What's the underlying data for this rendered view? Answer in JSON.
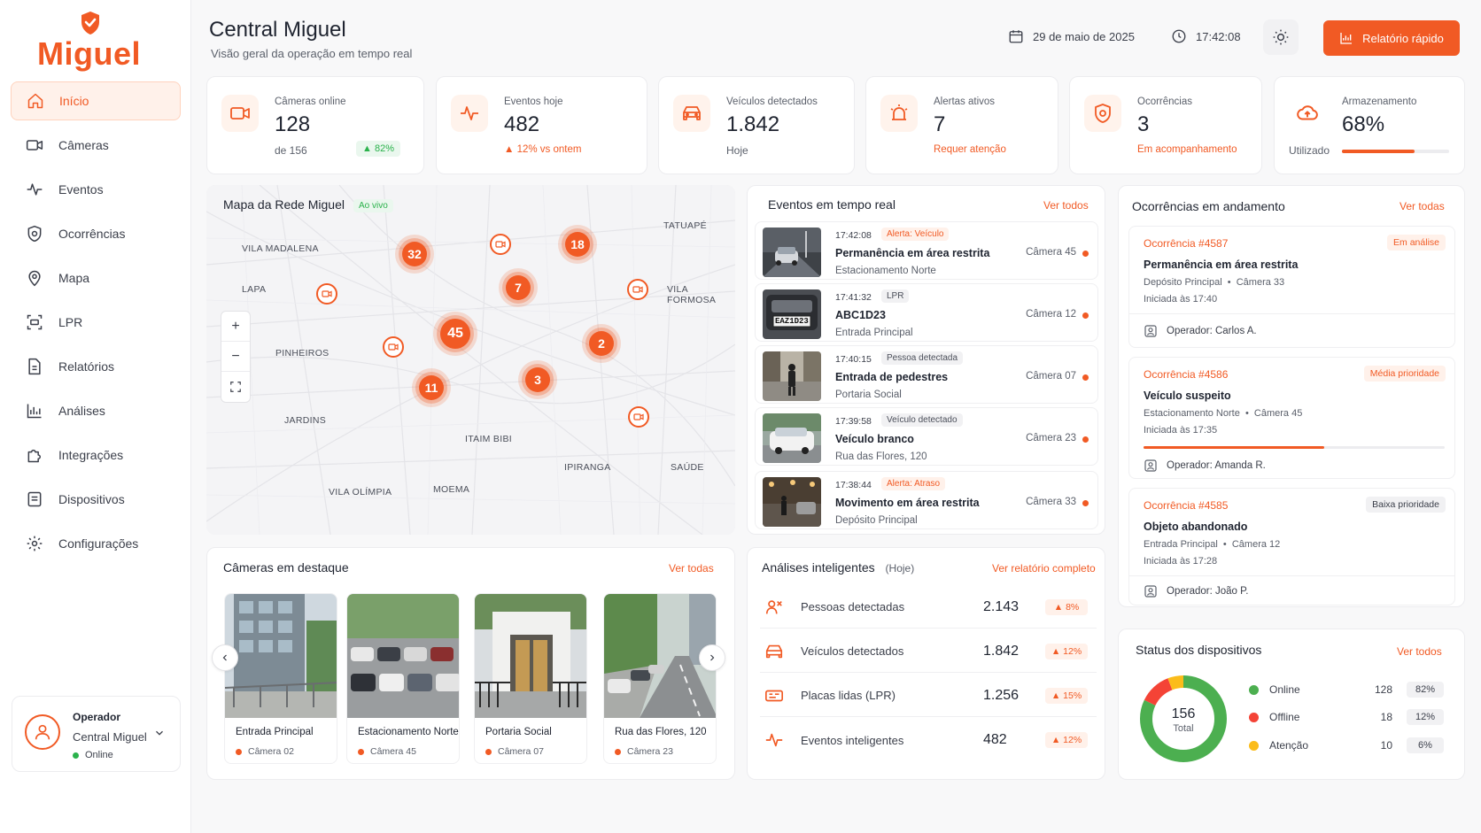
{
  "brand": {
    "name": "Miguel",
    "accent": "#f15a24"
  },
  "sidebar": {
    "items": [
      {
        "label": "Início",
        "icon": "home-icon"
      },
      {
        "label": "Câmeras",
        "icon": "camera-icon"
      },
      {
        "label": "Eventos",
        "icon": "activity-icon"
      },
      {
        "label": "Ocorrências",
        "icon": "shield-icon"
      },
      {
        "label": "Mapa",
        "icon": "map-pin-icon"
      },
      {
        "label": "LPR",
        "icon": "scan-plate-icon"
      },
      {
        "label": "Relatórios",
        "icon": "document-icon"
      },
      {
        "label": "Análises",
        "icon": "bar-chart-icon"
      },
      {
        "label": "Integrações",
        "icon": "puzzle-icon"
      },
      {
        "label": "Dispositivos",
        "icon": "device-icon"
      },
      {
        "label": "Configurações",
        "icon": "gear-icon"
      }
    ],
    "operator": {
      "role": "Operador",
      "name": "Central Miguel",
      "status": "Online"
    }
  },
  "header": {
    "title": "Central Miguel",
    "subtitle": "Visão geral da operação em tempo real",
    "date": "29 de maio de 2025",
    "time": "17:42:08",
    "quick_report": "Relatório rápido"
  },
  "kpis": {
    "cameras": {
      "label": "Câmeras online",
      "value": "128",
      "sub": "de 156",
      "badge": "82%"
    },
    "events": {
      "label": "Eventos hoje",
      "value": "482",
      "sub": "12% vs ontem"
    },
    "vehicles": {
      "label": "Veículos detectados",
      "value": "1.842",
      "sub": "Hoje"
    },
    "alerts": {
      "label": "Alertas ativos",
      "value": "7",
      "sub": "Requer atenção"
    },
    "occurrences": {
      "label": "Ocorrências",
      "value": "3",
      "sub": "Em acompanhamento"
    },
    "storage": {
      "label": "Armazenamento",
      "value": "68%",
      "sub": "Utilizado",
      "fraction": 0.68
    }
  },
  "map": {
    "title": "Mapa da Rede Miguel",
    "live": "Ao vivo",
    "places": [
      "VILA MADALENA",
      "TATUAPÉ",
      "LAPA",
      "VILA FORMOSA",
      "PINHEIROS",
      "JARDINS",
      "ITAIM BIBI",
      "IPIRANGA",
      "SAÚDE",
      "VILA OLÍMPIA",
      "MOEMA"
    ],
    "clusters": [
      "32",
      "18",
      "7",
      "45",
      "2",
      "11",
      "3"
    ],
    "zoom_in": "+",
    "zoom_out": "−"
  },
  "realtime": {
    "title": "Eventos em tempo real",
    "link": "Ver todos",
    "events": [
      {
        "time": "17:42:08",
        "tag": "Alerta: Veículo",
        "title": "Permanência em área restrita",
        "location": "Estacionamento Norte",
        "camera": "Câmera 45"
      },
      {
        "time": "17:41:32",
        "tag": "LPR",
        "title": "ABC1D23",
        "location": "Entrada Principal",
        "camera": "Câmera 12"
      },
      {
        "time": "17:40:15",
        "tag": "Pessoa detectada",
        "title": "Entrada de pedestres",
        "location": "Portaria Social",
        "camera": "Câmera 07"
      },
      {
        "time": "17:39:58",
        "tag": "Veículo detectado",
        "title": "Veículo branco",
        "location": "Rua das Flores, 120",
        "camera": "Câmera 23"
      },
      {
        "time": "17:38:44",
        "tag": "Alerta: Atraso",
        "title": "Movimento em área restrita",
        "location": "Depósito Principal",
        "camera": "Câmera 33"
      }
    ],
    "plate": "EAZ1D23"
  },
  "occurrences": {
    "title": "Ocorrências em andamento",
    "link": "Ver todas",
    "items": [
      {
        "id": "Ocorrência #4587",
        "status": "Em análise",
        "title": "Permanência em área restrita",
        "location": "Depósito Principal",
        "camera": "Câmera 33",
        "started": "Iniciada às 17:40",
        "operator": "Operador: Carlos A."
      },
      {
        "id": "Ocorrência #4586",
        "status": "Média prioridade",
        "title": "Veículo suspeito",
        "location": "Estacionamento Norte",
        "camera": "Câmera 45",
        "started": "Iniciada às 17:35",
        "operator": "Operador: Amanda R.",
        "progress": 0.6
      },
      {
        "id": "Ocorrência #4585",
        "status": "Baixa prioridade",
        "title": "Objeto abandonado",
        "location": "Entrada Principal",
        "camera": "Câmera 12",
        "started": "Iniciada às 17:28",
        "operator": "Operador: João P."
      }
    ]
  },
  "featured": {
    "title": "Câmeras em destaque",
    "link": "Ver todas",
    "cameras": [
      {
        "name": "Entrada Principal",
        "camera": "Câmera 02"
      },
      {
        "name": "Estacionamento Norte",
        "camera": "Câmera 45"
      },
      {
        "name": "Portaria Social",
        "camera": "Câmera 07"
      },
      {
        "name": "Rua das Flores, 120",
        "camera": "Câmera 23"
      }
    ]
  },
  "analytics": {
    "title": "Análises inteligentes",
    "period": "(Hoje)",
    "link": "Ver relatório completo",
    "rows": [
      {
        "label": "Pessoas detectadas",
        "value": "2.143",
        "change": "8%"
      },
      {
        "label": "Veículos detectados",
        "value": "1.842",
        "change": "12%"
      },
      {
        "label": "Placas lidas (LPR)",
        "value": "1.256",
        "change": "15%"
      },
      {
        "label": "Eventos inteligentes",
        "value": "482",
        "change": "12%"
      }
    ]
  },
  "devices": {
    "title": "Status dos dispositivos",
    "link": "Ver todos",
    "total": "156",
    "total_label": "Total",
    "rows": [
      {
        "label": "Online",
        "value": "128",
        "pct": "82%",
        "color": "#4caf50",
        "fraction": 0.82
      },
      {
        "label": "Offline",
        "value": "18",
        "pct": "12%",
        "color": "#f44336",
        "fraction": 0.12
      },
      {
        "label": "Atenção",
        "value": "10",
        "pct": "6%",
        "color": "#fbbc1a",
        "fraction": 0.06
      }
    ]
  }
}
